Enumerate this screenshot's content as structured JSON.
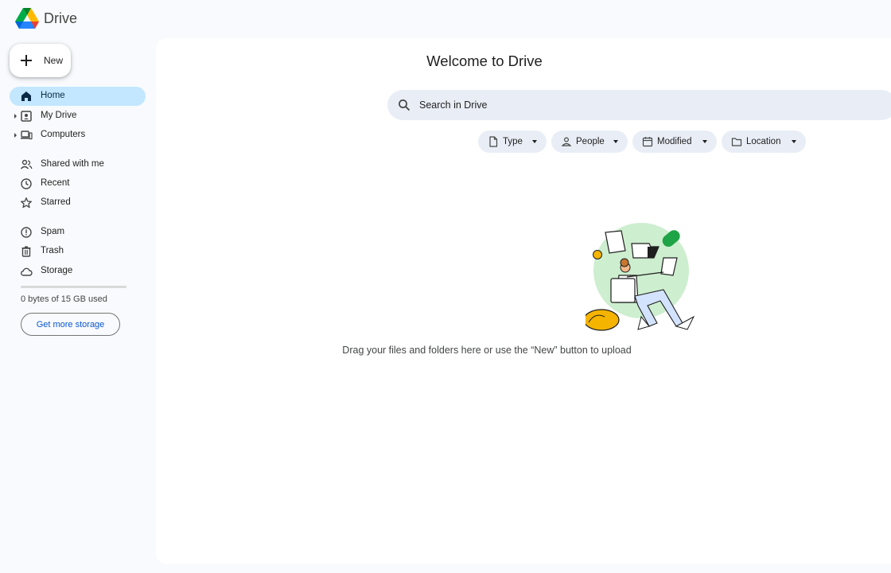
{
  "header": {
    "app_name": "Drive"
  },
  "new_button": {
    "label": "New"
  },
  "sidebar": {
    "items": [
      {
        "label": "Home",
        "icon": "home-icon"
      },
      {
        "label": "My Drive",
        "icon": "my-drive-icon"
      },
      {
        "label": "Computers",
        "icon": "computer-icon"
      },
      {
        "label": "Shared with me",
        "icon": "people-icon"
      },
      {
        "label": "Recent",
        "icon": "clock-icon"
      },
      {
        "label": "Starred",
        "icon": "star-icon"
      },
      {
        "label": "Spam",
        "icon": "spam-icon"
      },
      {
        "label": "Trash",
        "icon": "trash-icon"
      },
      {
        "label": "Storage",
        "icon": "cloud-icon"
      }
    ],
    "storage": {
      "used_text": "0 bytes of 15 GB used",
      "used_fraction": 0,
      "button_label": "Get more storage"
    }
  },
  "main": {
    "title": "Welcome to Drive",
    "search": {
      "placeholder": "Search in Drive"
    },
    "filters": [
      {
        "label": "Type",
        "icon": "file-icon"
      },
      {
        "label": "People",
        "icon": "person-icon"
      },
      {
        "label": "Modified",
        "icon": "calendar-icon"
      },
      {
        "label": "Location",
        "icon": "folder-icon"
      }
    ],
    "empty_message": "Drag your files and folders here or use the “New” button to upload"
  },
  "colors": {
    "active_nav": "#c2e7ff",
    "link": "#0b57d0",
    "chip_bg": "#e9eef6",
    "page_bg": "#f8fafd"
  }
}
